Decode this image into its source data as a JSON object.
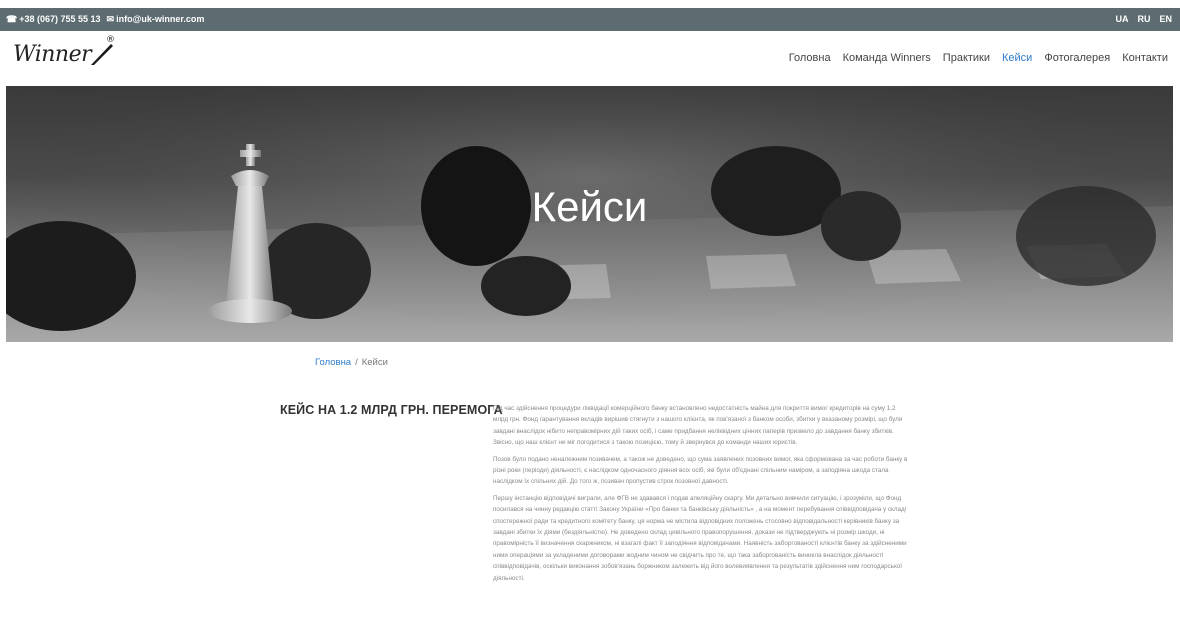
{
  "topbar": {
    "phone": "+38 (067) 755 55 13",
    "email": "info@uk-winner.com",
    "phone_icon": "phone-icon",
    "email_icon": "envelope-icon",
    "languages": [
      "UA",
      "RU",
      "EN"
    ]
  },
  "header": {
    "logo_text": "Winner",
    "logo_reg": "®",
    "nav": [
      {
        "label": "Головна"
      },
      {
        "label": "Команда Winners"
      },
      {
        "label": "Практики"
      },
      {
        "label": "Кейси",
        "active": true
      },
      {
        "label": "Фотогалерея"
      },
      {
        "label": "Контакти"
      }
    ]
  },
  "hero": {
    "title": "Кейси"
  },
  "breadcrumb": {
    "home": "Головна",
    "separator": "/",
    "current": "Кейси"
  },
  "case": {
    "title": "КЕЙС НА 1.2 МЛРД ГРН. ПЕРЕМОГА",
    "paragraphs": [
      "Під час здійснення процедури ліквідації комерційного банку встановлено недостатність майна для покриття вимог кредиторів на суму 1,2 млрд грн. Фонд гарантування вкладів вирішив стягнути з нашого клієнта, як пов'язаної з банком особи, збитки у вказаному розмірі, що були завдані внаслідок нібито неправомірних дій таких осіб, і саме придбання неліквідних цінних паперів призвело до завдання банку збитків. Звісно, що наш клієнт не міг погодитися з такою позицією, тому й звернувся до команди наших юристів.",
      "Позов було подано неналежним позивачем, а також не доведено, що сума заявлених позовних вимог, яка сформована за час роботи банку в різні роки (періоди) діяльності, є наслідком одночасного діяння всіх осіб, які були об'єднані спільним наміром, а заподіяна шкода стала наслідком їх спільних дій. До того ж, позивач пропустив строк позовної давності.",
      "Першу інстанцію відповідачі виграли, але ФГВ не здавався і подав апеляційну скаргу. Ми детально вивчили ситуацію, і зрозуміли, що Фонд посилався на чинну редакцію статті Закону України «Про банки та банківську діяльність» , а на момент перебування співвідповідача у складі спостережної ради та кредитного комітету банку, ця норма не містила відповідних положень стосовно відповідальності керівників банку за завдані збитки їх діями (бездіяльністю). Не доведено склад цивільного правопорушення, докази не підтверджують ні розмір шкоди, ні правомірність її визначення скаржником, ні взагалі факт її заподіяння відповідачами. Наявність заборгованості клієнтів банку за здійсненими ними операціями за укладеними договорами жодним чином не свідчить про те, що така заборгованість виникла внаслідок діяльності співвідповідачів, оскільки виконання зобов'язань боржником залежить від його волевиявлення та результатів здійснення ним господарської діяльності."
    ]
  }
}
